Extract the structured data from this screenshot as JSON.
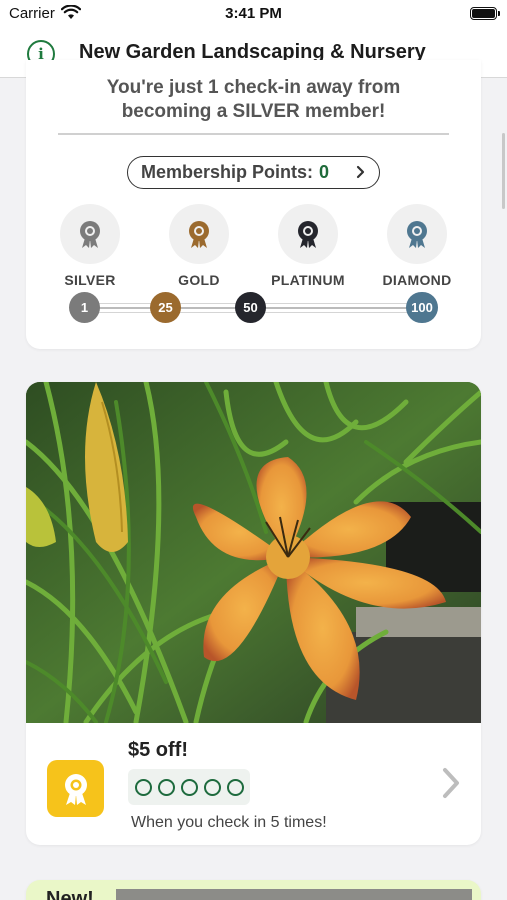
{
  "status_bar": {
    "carrier": "Carrier",
    "time": "3:41 PM"
  },
  "nav": {
    "title": "New Garden Landscaping & Nursery"
  },
  "membership": {
    "message_line1": "You're just 1 check-in away from",
    "message_line2": "becoming a SILVER member!",
    "points_label": "Membership Points:",
    "points_value": "0",
    "tiers": [
      {
        "name": "SILVER",
        "threshold": "1",
        "color": "#7b7b7b"
      },
      {
        "name": "GOLD",
        "threshold": "25",
        "color": "#9b6a2e"
      },
      {
        "name": "PLATINUM",
        "threshold": "50",
        "color": "#25262d"
      },
      {
        "name": "DIAMOND",
        "threshold": "100",
        "color": "#4f7790"
      }
    ]
  },
  "reward": {
    "title": "$5 off!",
    "stamps_total": 5,
    "stamps_filled": 0,
    "subtitle": "When you check in 5 times!",
    "icon_color": "#f6c31b"
  },
  "next_card": {
    "text": "New!"
  },
  "colors": {
    "brand_green": "#1f7a3e"
  }
}
